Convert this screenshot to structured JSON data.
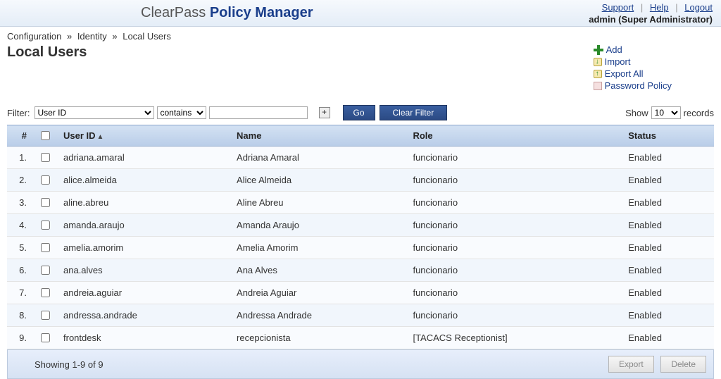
{
  "brand": {
    "light": "ClearPass",
    "bold": "Policy Manager"
  },
  "top_links": {
    "support": "Support",
    "help": "Help",
    "logout": "Logout"
  },
  "userline": "admin (Super Administrator)",
  "breadcrumb": {
    "a": "Configuration",
    "b": "Identity",
    "c": "Local Users"
  },
  "page_title": "Local Users",
  "actions": {
    "add": "Add",
    "import": "Import",
    "export_all": "Export All",
    "password_policy": "Password Policy"
  },
  "filter": {
    "label": "Filter:",
    "field": "User ID",
    "operator": "contains",
    "value": "",
    "go": "Go",
    "clear": "Clear Filter"
  },
  "records": {
    "show": "Show",
    "count": "10",
    "suffix": "records"
  },
  "columns": {
    "num": "#",
    "user_id": "User ID",
    "name": "Name",
    "role": "Role",
    "status": "Status"
  },
  "rows": [
    {
      "n": "1.",
      "user_id": "adriana.amaral",
      "name": "Adriana Amaral",
      "role": "funcionario",
      "status": "Enabled"
    },
    {
      "n": "2.",
      "user_id": "alice.almeida",
      "name": "Alice Almeida",
      "role": "funcionario",
      "status": "Enabled"
    },
    {
      "n": "3.",
      "user_id": "aline.abreu",
      "name": "Aline Abreu",
      "role": "funcionario",
      "status": "Enabled"
    },
    {
      "n": "4.",
      "user_id": "amanda.araujo",
      "name": "Amanda Araujo",
      "role": "funcionario",
      "status": "Enabled"
    },
    {
      "n": "5.",
      "user_id": "amelia.amorim",
      "name": "Amelia Amorim",
      "role": "funcionario",
      "status": "Enabled"
    },
    {
      "n": "6.",
      "user_id": "ana.alves",
      "name": "Ana Alves",
      "role": "funcionario",
      "status": "Enabled"
    },
    {
      "n": "7.",
      "user_id": "andreia.aguiar",
      "name": "Andreia Aguiar",
      "role": "funcionario",
      "status": "Enabled"
    },
    {
      "n": "8.",
      "user_id": "andressa.andrade",
      "name": "Andressa Andrade",
      "role": "funcionario",
      "status": "Enabled"
    },
    {
      "n": "9.",
      "user_id": "frontdesk",
      "name": "recepcionista",
      "role": "[TACACS Receptionist]",
      "status": "Enabled"
    }
  ],
  "footer": {
    "showing": "Showing 1-9 of 9",
    "export": "Export",
    "delete": "Delete"
  }
}
